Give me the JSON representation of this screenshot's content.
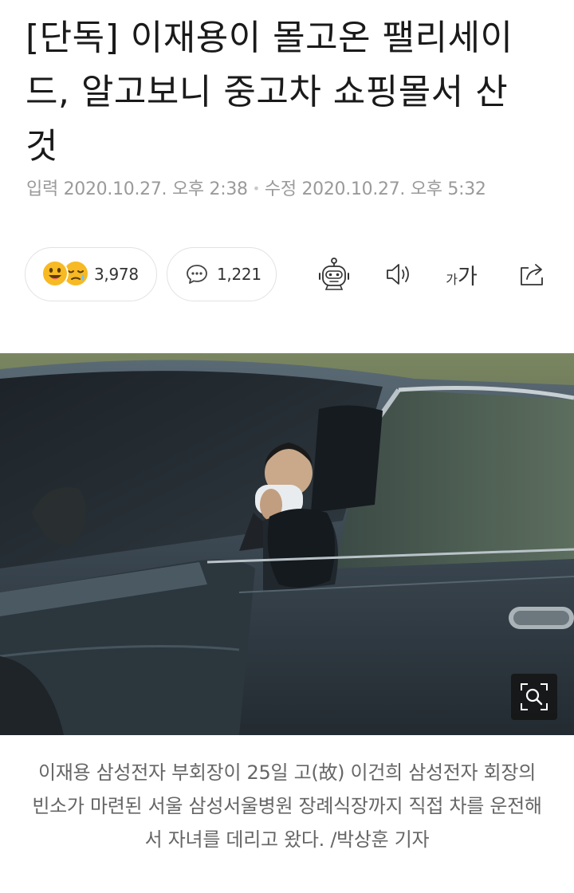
{
  "article": {
    "headline": "[단독] 이재용이 몰고온 팰리세이드, 알고보니 중고차 쇼핑몰서 산 것",
    "meta": {
      "input_label": "입력",
      "input_time": "2020.10.27. 오후 2:38",
      "modified_label": "수정",
      "modified_time": "2020.10.27. 오후 5:32"
    }
  },
  "actions": {
    "reaction_count": "3,978",
    "comment_count": "1,221",
    "icons": [
      "emoji-smile-icon",
      "emoji-sleepy-icon",
      "comment-icon",
      "robot-icon",
      "speaker-icon",
      "font-size-icon",
      "share-icon"
    ],
    "font_small": "가",
    "font_big": "가"
  },
  "photo": {
    "caption": "이재용 삼성전자 부회장이 25일 고(故) 이건희 삼성전자 회장의 빈소가 마련된 서울 삼성서울병원 장례식장까지 직접 차를 운전해서 자녀를 데리고 왔다. /박상훈 기자",
    "zoom_icon": "zoom-search-icon"
  },
  "colors": {
    "text": "#1a1a1a",
    "meta": "#9a9a9a",
    "caption": "#666666",
    "emoji": "#f7b924",
    "pill_border": "#e2e2e2"
  }
}
